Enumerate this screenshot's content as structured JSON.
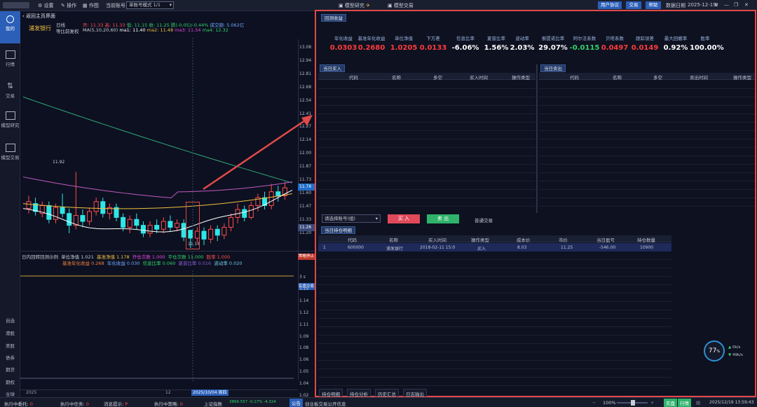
{
  "topbar": {
    "settings": "设置",
    "operate": "操作",
    "drawing": "作图",
    "current_account_label": "当前账号",
    "account_mode": "单账号模式 1/1",
    "tab_model_research": "模型研究",
    "tab_model_trade": "模型交易",
    "btn_user_agreement": "用户协议",
    "btn_trade": "交易",
    "btn_help": "帮助",
    "data_date_label": "数据日期",
    "data_date": "2025-12-19"
  },
  "leftnav": {
    "mine": "我的",
    "market": "行情",
    "trade": "交易",
    "model_research": "模型研究",
    "model_trade": "模型交易",
    "watchlist": "自选",
    "hk": "港股",
    "us": "美股",
    "bond": "债券",
    "futures": "期货",
    "options": "期权",
    "global": "全球"
  },
  "chart": {
    "back": "返回主页界面",
    "stock_name": "浦发银行",
    "period": "日线",
    "adjust": "等比前复权",
    "ma_label": "MA(5,10,20,60)",
    "open": "开: 11.33",
    "high": "高: 11.33",
    "low": "低: 11.15",
    "close": "收: 11.25",
    "change": "跌(-0.05)/-0.44%",
    "volume": "成交额: 5.062亿",
    "ma1": "ma1: 11.40",
    "ma2": "ma2: 11.48",
    "ma3": "ma3: 11.54",
    "ma4": "ma4: 12.32",
    "high_marker": "11.92",
    "low_marker": "11.14",
    "current_price": "11.26",
    "live_price": "11.76",
    "price_ticks": [
      "13.08",
      "12.94",
      "12.81",
      "12.68",
      "12.54",
      "12.41",
      "12.27",
      "12.14",
      "12.00",
      "11.87",
      "11.73",
      "11.60",
      "11.47",
      "11.33",
      "11.20"
    ],
    "x_start": "2025",
    "x_mid": "12",
    "x_cursor": "2025/10/04 周四",
    "sub_title": "日内回转回测示例",
    "sub_unit_nav_label": "单位净值",
    "sub_unit_nav": "1.021",
    "sub_bench_nav_label": "基准净值",
    "sub_bench_nav": "1.178",
    "sub_open_count_label": "开仓次数",
    "sub_open_count": "1.000",
    "sub_close_count_label": "平仓次数",
    "sub_close_count": "11.000",
    "sub_win_label": "胜率",
    "sub_win": "1.000",
    "sub_bench_annual_label": "基准年化收益",
    "sub_bench_annual": "0.268",
    "sub_annual_label": "年化收益",
    "sub_annual": "0.030",
    "sub_info_label": "信息比率",
    "sub_info": "0.060",
    "sub_sharpe_label": "夏普比率",
    "sub_sharpe": "0.016",
    "sub_vol_label": "波动率",
    "sub_vol": "0.020",
    "sub_ticks": [
      "3 s",
      "1.15",
      "1.14",
      "1.12",
      "1.11",
      "1.09",
      "1.08",
      "1.06",
      "1.05",
      "1.04",
      "1.02"
    ],
    "sub_tag_top": "策略停止",
    "sub_tag_mid": "实盘交易"
  },
  "results": {
    "tag": "回测收益",
    "metrics": [
      {
        "label": "年化收益",
        "value": "0.0303",
        "color": "#ff3b3b"
      },
      {
        "label": "基准年化收益",
        "value": "0.2680",
        "color": "#ff3b3b"
      },
      {
        "label": "单位净值",
        "value": "1.0205",
        "color": "#ff3b3b"
      },
      {
        "label": "下方差",
        "value": "0.0133",
        "color": "#ff3b3b"
      },
      {
        "label": "信息比率",
        "value": "-6.06%",
        "color": "#ffffff"
      },
      {
        "label": "夏普比率",
        "value": "1.56%",
        "color": "#ffffff"
      },
      {
        "label": "波动率",
        "value": "2.03%",
        "color": "#ffffff"
      },
      {
        "label": "索提诺比率",
        "value": "29.07%",
        "color": "#ffffff"
      },
      {
        "label": "阿尔法系数",
        "value": "-0.0115",
        "color": "#2fd36b"
      },
      {
        "label": "贝塔系数",
        "value": "0.0497",
        "color": "#ff3b3b"
      },
      {
        "label": "跟踪误差",
        "value": "0.0149",
        "color": "#ff3b3b"
      },
      {
        "label": "最大回撤率",
        "value": "0.92%",
        "color": "#ffffff"
      },
      {
        "label": "胜率",
        "value": "100.00%",
        "color": "#ffffff"
      }
    ],
    "buy_tag": "当日买入",
    "buy_cols": [
      "代码",
      "名称",
      "多空",
      "买入时间",
      "操作类型"
    ],
    "sell_tag": "当日卖出",
    "sell_cols": [
      "代码",
      "名称",
      "多空",
      "卖出时间",
      "操作类型"
    ],
    "account_select": "请选择账号(组)",
    "buy_btn": "买 入",
    "sell_btn": "卖 出",
    "normal_trade": "普通交易",
    "hold_tag": "当日持仓明细",
    "hold_cols": [
      "代码",
      "名称",
      "买入时间",
      "操作类型",
      "成本价",
      "市价",
      "当日盈亏",
      "持仓数量"
    ],
    "hold_rows": [
      {
        "idx": "1",
        "code": "600000",
        "name": "浦发银行",
        "time": "2018-02-11 15:0",
        "op": "买入",
        "cost": "8.03",
        "price": "11.25",
        "pnl": "-546.00",
        "qty": "10900"
      }
    ],
    "tabs": [
      "持仓明细",
      "持仓分析",
      "历史汇总",
      "日志输出"
    ],
    "gauge": "77",
    "gauge_unit": "%",
    "up_speed": "0k/s",
    "down_speed": "49k/s"
  },
  "statusbar": {
    "s1": "执行中委托",
    "s1v": "0",
    "s2": "执行中任务",
    "s2v": "0",
    "s3": "消息提示:",
    "s3v": "P",
    "s4": "执行中策略:",
    "s4v": "0",
    "index_name": "上证指数",
    "index_val": "3866.557 -0.17% -4.324",
    "notice_tag": "公告",
    "notice": "创业板交易公开信息",
    "zoom": "100%",
    "mode_real": "实盘",
    "mode_quote": "行情",
    "clock": "2025/12/19 13:59:43"
  }
}
